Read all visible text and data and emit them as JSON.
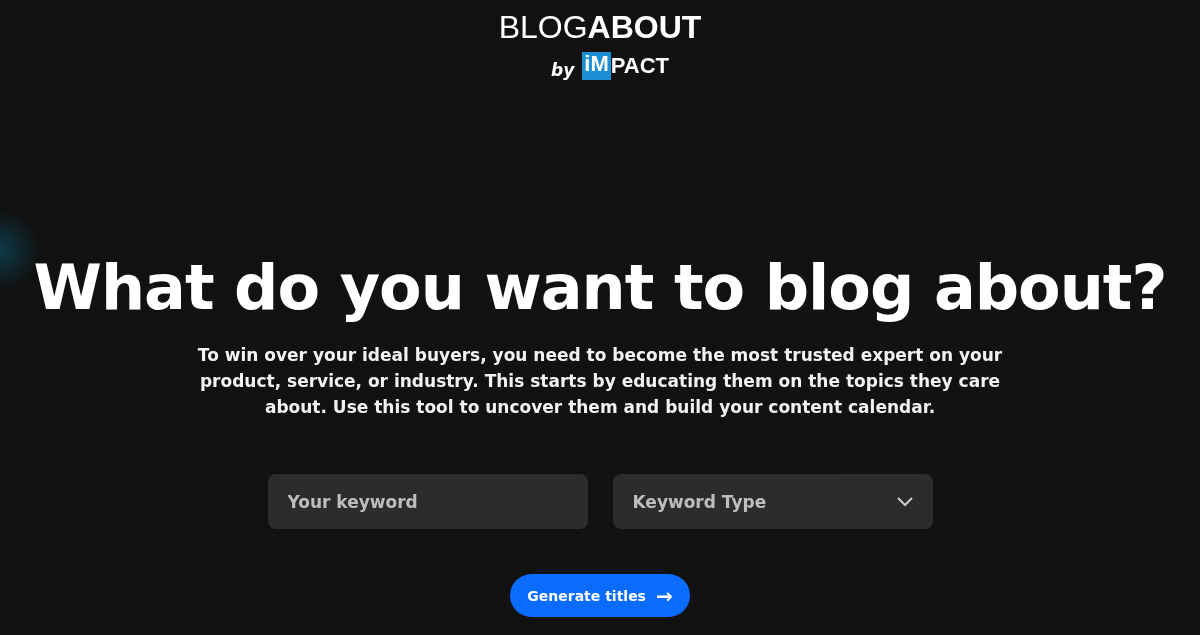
{
  "logo": {
    "wordmark": "BLOG**ABOUT**",
    "by": "by",
    "brand_box": "iM",
    "brand_rest": "PACT"
  },
  "heading": "What do you want to blog about?",
  "intro": "To win over your ideal buyers, you need to become the most trusted expert on your product, service, or industry. This starts by educating them on the topics they care about. Use this tool to uncover them and build your content calendar.",
  "form": {
    "keyword": {
      "placeholder": "Your keyword"
    },
    "keyword_type": {
      "placeholder": "Keyword Type"
    },
    "submit": {
      "label": "Generate titles",
      "icon": "→"
    }
  }
}
